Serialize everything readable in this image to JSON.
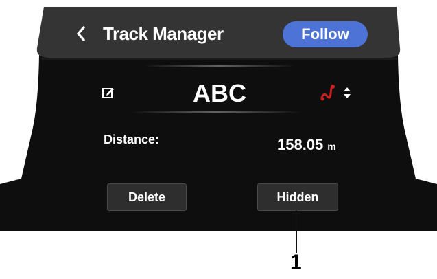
{
  "header": {
    "title": "Track Manager",
    "follow_label": "Follow"
  },
  "track": {
    "name": "ABC",
    "route_color": "#cc1e1e"
  },
  "details": {
    "distance_label": "Distance:",
    "distance_value": "158.05",
    "distance_unit": "m"
  },
  "actions": {
    "delete_label": "Delete",
    "hidden_label": "Hidden"
  },
  "callout": {
    "number": "1"
  },
  "icons": [
    "back-icon",
    "edit-icon",
    "route-icon",
    "sort-icon"
  ],
  "colors": {
    "accent": "#4d73d6",
    "panel": "#111111",
    "header": "#333333"
  }
}
